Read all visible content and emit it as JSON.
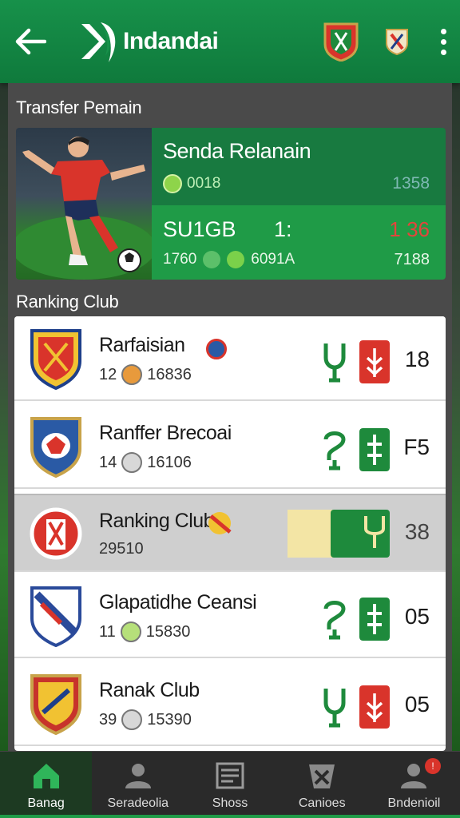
{
  "header": {
    "title": "Indandai"
  },
  "transfer": {
    "section_title": "Transfer Pemain",
    "player_name": "Senda Relanain",
    "stat_a": "0018",
    "stat_a_right": "1358",
    "code": "SU1GB",
    "colon": "1:",
    "red_value": "1 36",
    "stats_b1": "1760",
    "stats_b2": "6091A",
    "stats_b_right": "7188"
  },
  "ranking": {
    "section_title": "Ranking Club",
    "rows": [
      {
        "name": "Rarfaisian",
        "num": "12",
        "sub": "16836",
        "score": "18",
        "icon2_color": "#d9342b",
        "crest_color": "#d9342b"
      },
      {
        "name": "Ranffer Brecoai",
        "num": "14",
        "sub": "16106",
        "score": "F5",
        "icon2_color": "#1e8a3c",
        "crest_color": "#2a5aa5"
      },
      {
        "name": "Ranking Club",
        "num": "",
        "sub": "29510",
        "score": "38",
        "icon2_color": "#1e8a3c",
        "crest_color": "#d9342b"
      },
      {
        "name": "Glapatidhe Ceansi",
        "num": "11",
        "sub": "15830",
        "score": "05",
        "icon2_color": "#1e8a3c",
        "crest_color": "#2a4a9a"
      },
      {
        "name": "Ranak Club",
        "num": "39",
        "sub": "15390",
        "score": "05",
        "icon2_color": "#d9342b",
        "crest_color": "#c7332b"
      }
    ]
  },
  "nav": {
    "items": [
      {
        "label": "Banag",
        "icon": "home-icon"
      },
      {
        "label": "Seradeolia",
        "icon": "profile-icon"
      },
      {
        "label": "Shoss",
        "icon": "news-icon"
      },
      {
        "label": "Canioes",
        "icon": "ball-icon"
      },
      {
        "label": "Bndenioil",
        "icon": "user-icon"
      }
    ],
    "badge": "!"
  },
  "colors": {
    "brand": "#17914a",
    "accent_red": "#d9342b",
    "dark_bg": "#2a2a2a"
  }
}
